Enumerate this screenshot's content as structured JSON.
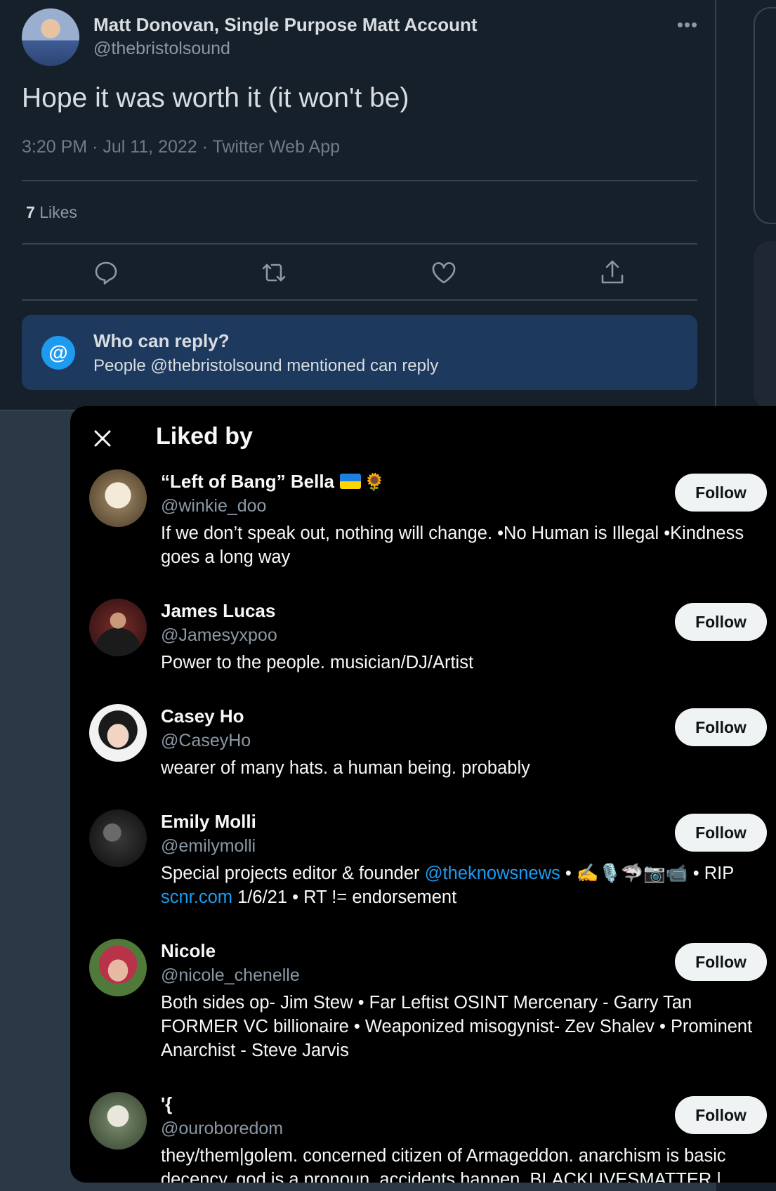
{
  "tweet": {
    "author_name": "Matt Donovan, Single Purpose Matt Account",
    "author_handle": "@thebristolsound",
    "text": "Hope it was worth it (it won't be)",
    "meta": "3:20 PM · Jul 11, 2022 · Twitter Web App",
    "likes_number": "7",
    "likes_label": "Likes",
    "reply_title": "Who can reply?",
    "reply_subtitle": "People @thebristolsound mentioned can reply",
    "more_icon": "ellipsis-icon",
    "actions": [
      "reply-icon",
      "retweet-icon",
      "like-icon",
      "share-icon"
    ]
  },
  "modal": {
    "title": "Liked by",
    "close_icon": "close-icon",
    "follow_label": "Follow",
    "users": [
      {
        "name": "“Left of Bang” Bella",
        "handle": "@winkie_doo",
        "bio": "If we don’t speak out, nothing will change. •No Human is Illegal •Kindness goes a long way"
      },
      {
        "name": "James Lucas",
        "handle": "@Jamesyxpoo",
        "bio": "Power to the people. musician/DJ/Artist"
      },
      {
        "name": "Casey Ho",
        "handle": "@CaseyHo",
        "bio": "wearer of many hats. a human being. probably"
      },
      {
        "name": "Emily Molli",
        "handle": "@emilymolli",
        "bio_parts": [
          "Special projects editor & founder ",
          "@theknowsnews",
          " • ✍️🎙️🦈📷📹 • RIP ",
          "scnr.com",
          " 1/6/21 • RT != endorsement"
        ]
      },
      {
        "name": "Nicole",
        "handle": "@nicole_chenelle",
        "bio": "Both sides op- Jim Stew • Far Leftist OSINT Mercenary - Garry Tan FORMER VC billionaire • Weaponized misogynist- Zev Shalev • Prominent Anarchist - Steve Jarvis"
      },
      {
        "name": "'{",
        "handle": "@ouroboredom",
        "bio": "they/them|golem. concerned citizen of Armageddon. anarchism is basic decency. god is a pronoun. accidents happen. BLACKLIVESMATTER |"
      }
    ]
  },
  "colors": {
    "accent": "#1d9bf0",
    "background": "#15202b",
    "modal": "#000000"
  }
}
